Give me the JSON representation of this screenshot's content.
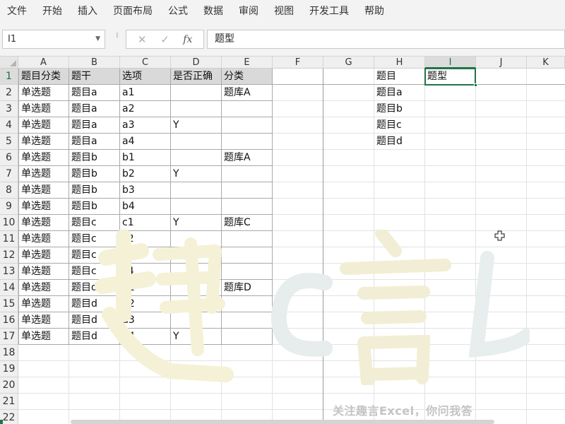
{
  "menu": [
    "文件",
    "开始",
    "插入",
    "页面布局",
    "公式",
    "数据",
    "审阅",
    "视图",
    "开发工具",
    "帮助"
  ],
  "formula_bar": {
    "name_box": "I1",
    "cancel_icon": "✕",
    "enter_icon": "✓",
    "fx_label": "fx",
    "formula": "题型"
  },
  "columns": [
    "A",
    "B",
    "C",
    "D",
    "E",
    "F",
    "G",
    "H",
    "I",
    "J",
    "K"
  ],
  "rows": [
    "1",
    "2",
    "3",
    "4",
    "5",
    "6",
    "7",
    "8",
    "9",
    "10",
    "11",
    "12",
    "13",
    "14",
    "15",
    "16",
    "17",
    "18",
    "19",
    "20",
    "21",
    "22"
  ],
  "table": {
    "headers": [
      "题目分类",
      "题干",
      "选项",
      "是否正确",
      "分类"
    ],
    "rows": [
      [
        "单选题",
        "题目a",
        "a1",
        "",
        "题库A"
      ],
      [
        "单选题",
        "题目a",
        "a2",
        "",
        ""
      ],
      [
        "单选题",
        "题目a",
        "a3",
        "Y",
        ""
      ],
      [
        "单选题",
        "题目a",
        "a4",
        "",
        ""
      ],
      [
        "单选题",
        "题目b",
        "b1",
        "",
        "题库A"
      ],
      [
        "单选题",
        "题目b",
        "b2",
        "Y",
        ""
      ],
      [
        "单选题",
        "题目b",
        "b3",
        "",
        ""
      ],
      [
        "单选题",
        "题目b",
        "b4",
        "",
        ""
      ],
      [
        "单选题",
        "题目c",
        "c1",
        "Y",
        "题库C"
      ],
      [
        "单选题",
        "题目c",
        "c2",
        "",
        ""
      ],
      [
        "单选题",
        "题目c",
        "c3",
        "",
        ""
      ],
      [
        "单选题",
        "题目c",
        "c4",
        "",
        ""
      ],
      [
        "单选题",
        "题目d",
        "d1",
        "",
        "题库D"
      ],
      [
        "单选题",
        "题目d",
        "d2",
        "",
        ""
      ],
      [
        "单选题",
        "题目d",
        "d3",
        "",
        ""
      ],
      [
        "单选题",
        "题目d",
        "d4",
        "Y",
        ""
      ]
    ]
  },
  "lookup": {
    "h_header": "题目",
    "i_header": "题型",
    "items": [
      "题目a",
      "题目b",
      "题目c",
      "题目d"
    ]
  },
  "selection": {
    "column": "I",
    "row": "1"
  },
  "footer_text": "关注趣言Excel，你问我答",
  "colors": {
    "accent": "#217346",
    "header_fill": "#d9d9d9",
    "watermark": "#f3f0d2"
  },
  "icons": {
    "name_box_dropdown": "chevron-down-icon",
    "cancel": "close-icon",
    "enter": "check-icon",
    "cursor": "crosshair-icon"
  }
}
